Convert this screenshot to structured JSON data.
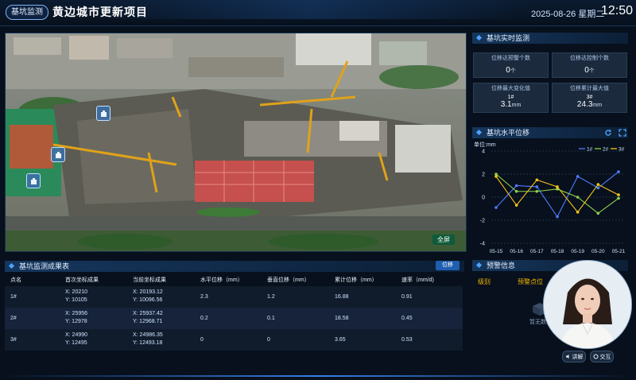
{
  "header": {
    "badge": "基坑监测",
    "title": "黄边城市更新项目",
    "date": "2025-08-26 星期二",
    "time": "12:50"
  },
  "photo": {
    "fullscreen_label": "全屏"
  },
  "realtime": {
    "title": "基坑实时监测",
    "stats": [
      {
        "label": "位移达预警个数",
        "value": "0",
        "unit": "个"
      },
      {
        "label": "位移达控制个数",
        "value": "0",
        "unit": "个"
      },
      {
        "label": "位移最大变化值",
        "point": "1#",
        "value": "3.1",
        "unit": "mm"
      },
      {
        "label": "位移累计最大值",
        "point": "3#",
        "value": "24.3",
        "unit": "mm"
      }
    ]
  },
  "chart_panel": {
    "title": "基坑水平位移",
    "unit_label": "单位:mm"
  },
  "chart_data": {
    "type": "line",
    "x": [
      "05-15",
      "05-16",
      "05-17",
      "05-18",
      "05-19",
      "05-20",
      "05-21"
    ],
    "ylim": [
      -4,
      4
    ],
    "yticks": [
      4,
      2,
      0,
      -2,
      -4
    ],
    "grid": true,
    "legend_position": "top-right",
    "series": [
      {
        "name": "1#",
        "color": "#4f7bff",
        "values": [
          -0.9,
          1.0,
          0.9,
          -1.7,
          1.8,
          0.8,
          2.2
        ]
      },
      {
        "name": "2#",
        "color": "#8fd14f",
        "values": [
          2.0,
          0.5,
          0.5,
          0.7,
          0.0,
          -1.4,
          -0.1
        ]
      },
      {
        "name": "3#",
        "color": "#f5c518",
        "values": [
          1.8,
          -0.7,
          1.5,
          0.9,
          -1.3,
          1.1,
          0.2
        ]
      }
    ]
  },
  "results": {
    "title": "基坑监测成果表",
    "mode_button": "位移",
    "columns": [
      "点名",
      "首次坐标成果",
      "当前坐标成果",
      "水平位移（mm）",
      "垂直位移（mm）",
      "累计位移（mm）",
      "速率（mm/d)"
    ],
    "rows": [
      {
        "point": "1#",
        "first_x": "X:   20210",
        "first_y": "Y:   10105",
        "cur_x": "X:   20193.12",
        "cur_y": "Y:   10096.56",
        "horizontal": "2.3",
        "vertical": "1.2",
        "cumulative": "16.88",
        "rate": "0.91"
      },
      {
        "point": "2#",
        "first_x": "X:   25956",
        "first_y": "Y:   12978",
        "cur_x": "X:   25937.42",
        "cur_y": "Y:   12968.71",
        "horizontal": "0.2",
        "vertical": "0.1",
        "cumulative": "18.58",
        "rate": "0.45"
      },
      {
        "point": "3#",
        "first_x": "X:   24990",
        "first_y": "Y:   12495",
        "cur_x": "X:   24986.35",
        "cur_y": "Y:   12493.18",
        "horizontal": "0",
        "vertical": "0",
        "cumulative": "3.65",
        "rate": "0.53"
      }
    ]
  },
  "alerts": {
    "title": "预警信息",
    "col_level": "级别",
    "col_point": "预警点位",
    "empty_text": "暂无数据"
  },
  "assistant": {
    "explain_label": "讲解",
    "interact_label": "交互"
  }
}
